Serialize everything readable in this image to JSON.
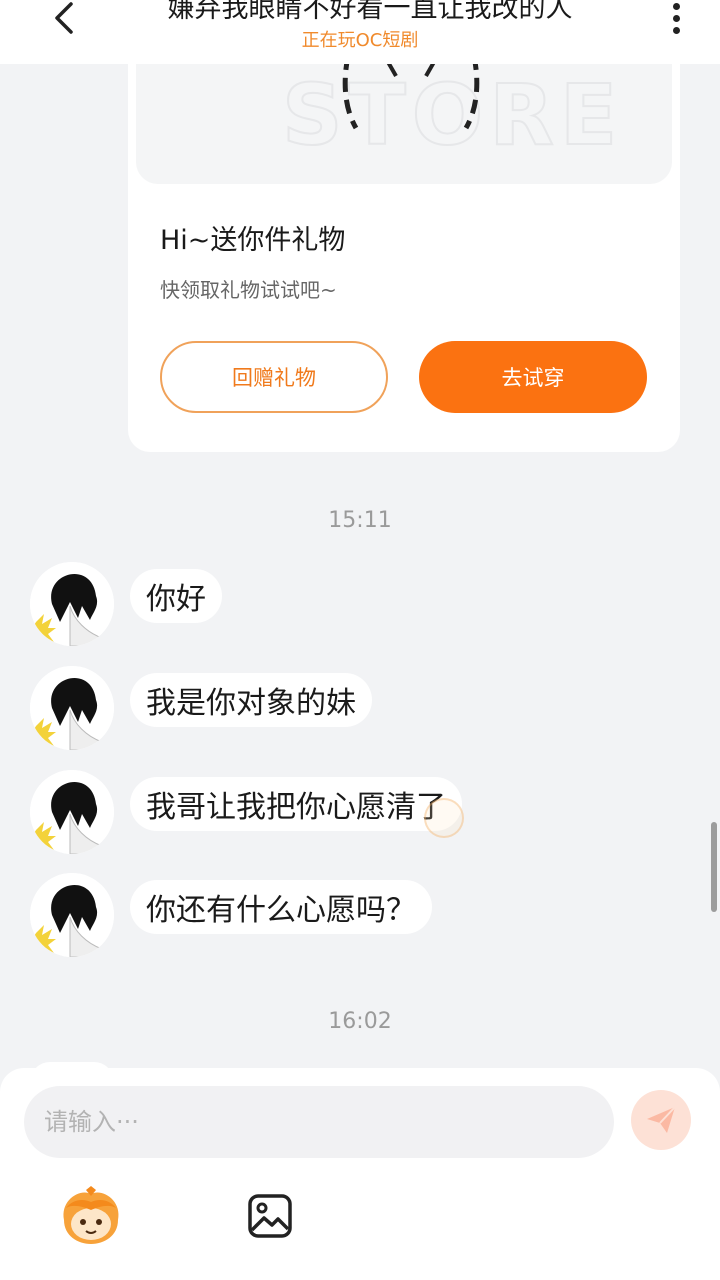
{
  "header": {
    "title": "嫌弃我眼睛不好看一直让我改的人",
    "subtitle": "正在玩OC短剧"
  },
  "gift_card": {
    "watermark": "STORE",
    "title": "Hi~送你件礼物",
    "desc": "快领取礼物试试吧~",
    "return_gift_label": "回赠礼物",
    "try_on_label": "去试穿"
  },
  "timestamps": [
    "15:11",
    "16:02"
  ],
  "messages": [
    {
      "text": "你好"
    },
    {
      "text": "我是你对象的妹"
    },
    {
      "text": "我哥让我把你心愿清了"
    },
    {
      "text": "你还有什么心愿吗？"
    }
  ],
  "input": {
    "placeholder": "请输入···"
  },
  "icons": {
    "back": "back-arrow-icon",
    "more": "more-vertical-icon",
    "send": "send-icon",
    "mascot": "mascot-icon",
    "image": "image-icon"
  },
  "colors": {
    "accent": "#fb7211",
    "accent_text": "#f08a2c",
    "send_bg": "#fde1d6"
  }
}
